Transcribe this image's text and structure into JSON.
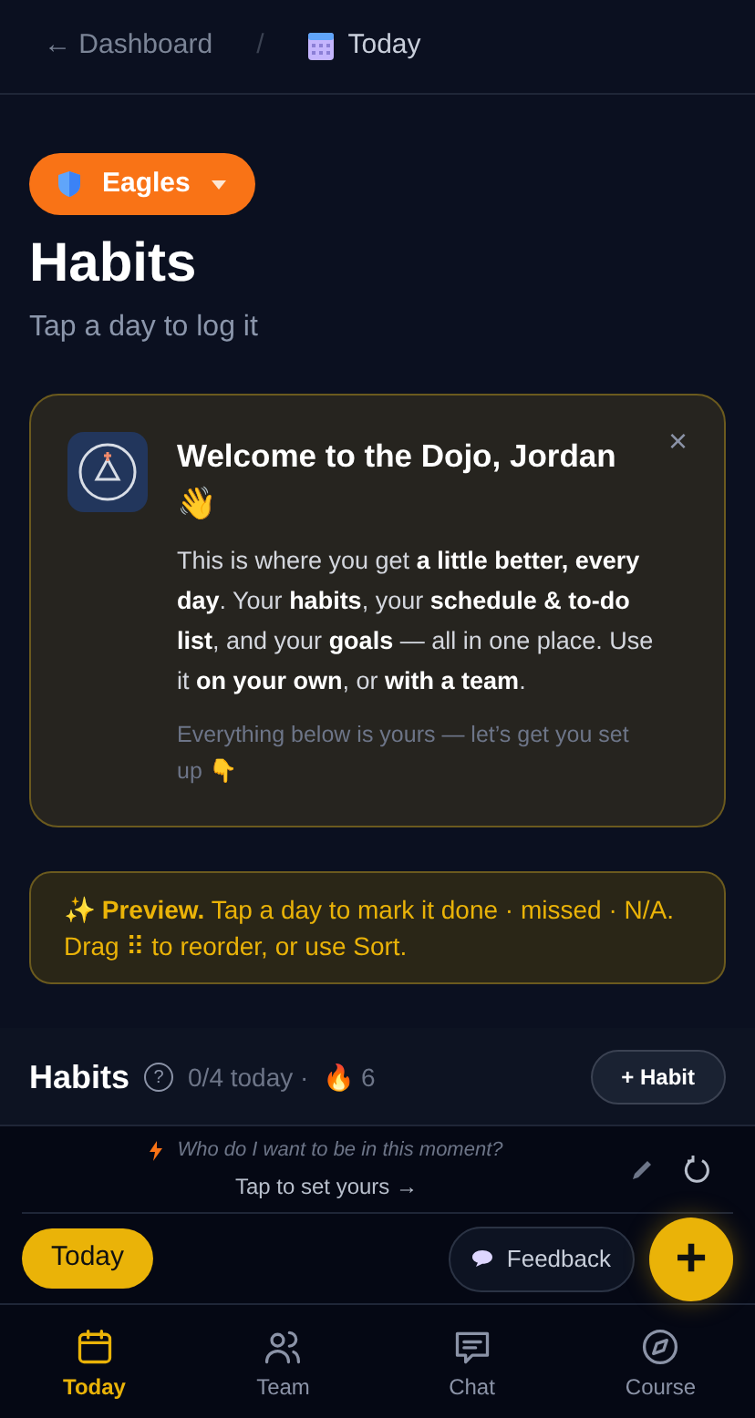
{
  "breadcrumb": {
    "back": "← Dashboard",
    "separator": "/",
    "current": "Today"
  },
  "team_button": {
    "label": "Eagles"
  },
  "title": "Habits",
  "subtitle": "Tap a day to log it",
  "welcome": {
    "title": "Welcome to the Dojo, Jordan 👋",
    "body": "This is where you get **a little better, every day**. Your **habits**, your **schedule & to-do list**, and your **goals** — all in one place. Use it **on your own**, or **with a team**.",
    "note": "Everything below is yours — let’s get you set up 👇",
    "close": "×"
  },
  "preview": "✨ **Preview.** Tap a day to mark it done · missed · N/A. Drag ⠿ to reorder, or use Sort.",
  "habits_header": {
    "title": "Habits",
    "help": "?",
    "progress": "0/4 today ·",
    "streak": "🔥 6",
    "add_button": "+ Habit"
  },
  "prompt": {
    "question": "Who do I want to be in this moment?",
    "action": "Tap to set yours →"
  },
  "today_button": "Today",
  "feedback_button": "Feedback",
  "fab": "+",
  "nav": [
    {
      "label": "Today",
      "selected": true
    },
    {
      "label": "Team",
      "selected": false
    },
    {
      "label": "Chat",
      "selected": false
    },
    {
      "label": "Course",
      "selected": false
    }
  ]
}
